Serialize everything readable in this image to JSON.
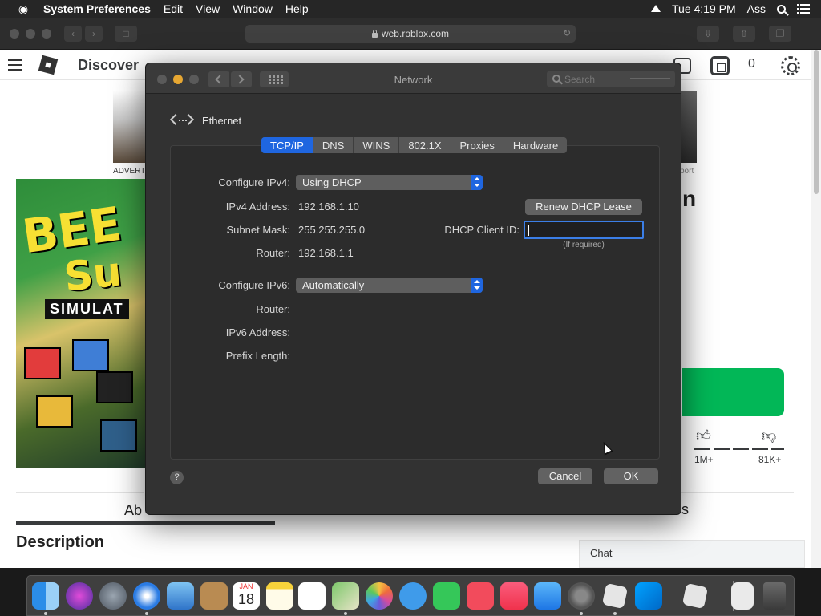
{
  "menubar": {
    "apple": "",
    "app_name": "System Preferences",
    "menus": [
      "Edit",
      "View",
      "Window",
      "Help"
    ],
    "clock": "Tue 4:19 PM",
    "user": "Ass"
  },
  "safari": {
    "url": "web.roblox.com"
  },
  "roblox_page": {
    "nav_discover": "Discover",
    "robux_count": "0",
    "ad_left_label": "ADVERT",
    "ad_right_label": "port",
    "thumb_line1": "BEE",
    "thumb_line2": "Su",
    "thumb_line3": "SIMULAT",
    "title_fragment": "n",
    "likes": "1M+",
    "dislikes": "81K+",
    "tab_left": "Ab",
    "tab_right": "s",
    "description_heading": "Description",
    "chat_label": "Chat"
  },
  "network_window": {
    "title": "Network",
    "search_placeholder": "Search",
    "interface_name": "Ethernet",
    "tabs": [
      {
        "label": "TCP/IP",
        "active": true
      },
      {
        "label": "DNS",
        "active": false
      },
      {
        "label": "WINS",
        "active": false
      },
      {
        "label": "802.1X",
        "active": false
      },
      {
        "label": "Proxies",
        "active": false
      },
      {
        "label": "Hardware",
        "active": false
      }
    ],
    "configure_ipv4_label": "Configure IPv4:",
    "configure_ipv4_value": "Using DHCP",
    "ipv4_address_label": "IPv4 Address:",
    "ipv4_address_value": "192.168.1.10",
    "subnet_mask_label": "Subnet Mask:",
    "subnet_mask_value": "255.255.255.0",
    "router_label": "Router:",
    "router_value": "192.168.1.1",
    "renew_button": "Renew DHCP Lease",
    "dhcp_client_id_label": "DHCP Client ID:",
    "dhcp_client_id_value": "",
    "if_required": "(If required)",
    "configure_ipv6_label": "Configure IPv6:",
    "configure_ipv6_value": "Automatically",
    "ipv6_router_label": "Router:",
    "ipv6_address_label": "IPv6 Address:",
    "prefix_length_label": "Prefix Length:",
    "help_label": "?",
    "cancel_button": "Cancel",
    "ok_button": "OK"
  },
  "dock": {
    "items": [
      "finder-icon",
      "siri-icon",
      "launchpad-icon",
      "safari-icon",
      "mail-icon",
      "contacts-icon",
      "calendar-icon",
      "notes-icon",
      "reminders-icon",
      "maps-icon",
      "photos-icon",
      "messages-icon",
      "facetime-icon",
      "news-icon",
      "music-icon",
      "app-store-icon",
      "system-preferences-icon",
      "roblox-icon",
      "roblox-studio-icon",
      "roblox-player-icon",
      "document-icon",
      "trash-icon"
    ],
    "calendar_month": "JAN",
    "calendar_day": "18"
  },
  "colors": {
    "accent_blue": "#1f66e0",
    "focus_ring": "#3b7ee6",
    "roblox_green": "#02b757",
    "window_bg": "#323232"
  }
}
